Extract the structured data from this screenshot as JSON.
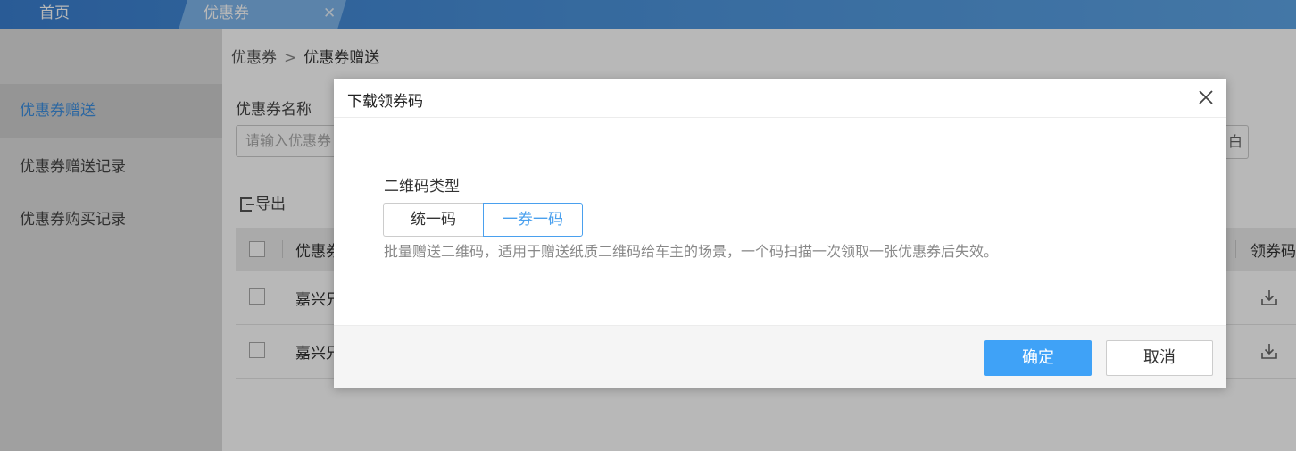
{
  "tabs": {
    "home": "首页",
    "coupon": "优惠券",
    "close_glyph": "✕"
  },
  "sidebar": {
    "items": [
      {
        "label": "优惠券赠送",
        "active": true
      },
      {
        "label": "优惠券赠送记录",
        "active": false
      },
      {
        "label": "优惠券购买记录",
        "active": false
      }
    ]
  },
  "breadcrumb": {
    "root": "优惠券",
    "separator": ">",
    "current": "优惠券赠送"
  },
  "filter": {
    "label": "优惠券名称",
    "placeholder": "请输入优惠券",
    "right_button_fragment": "白"
  },
  "toolbar": {
    "export_label": "导出"
  },
  "table": {
    "header_first": "优惠券",
    "header_last": "领券码",
    "rows": [
      {
        "name": "嘉兴兄"
      },
      {
        "name": "嘉兴兄"
      }
    ]
  },
  "modal": {
    "title": "下载领券码",
    "field_label": "二维码类型",
    "options": [
      {
        "label": "统一码",
        "selected": false
      },
      {
        "label": "一券一码",
        "selected": true
      }
    ],
    "hint": "批量赠送二维码，适用于赠送纸质二维码给车主的场景，一个码扫描一次领取一张优惠券后失效。",
    "confirm_label": "确定",
    "cancel_label": "取消"
  },
  "colors": {
    "accent": "#3fa2f7",
    "tabbar": "#4b93dc",
    "selected_text": "#4aa0ee"
  }
}
